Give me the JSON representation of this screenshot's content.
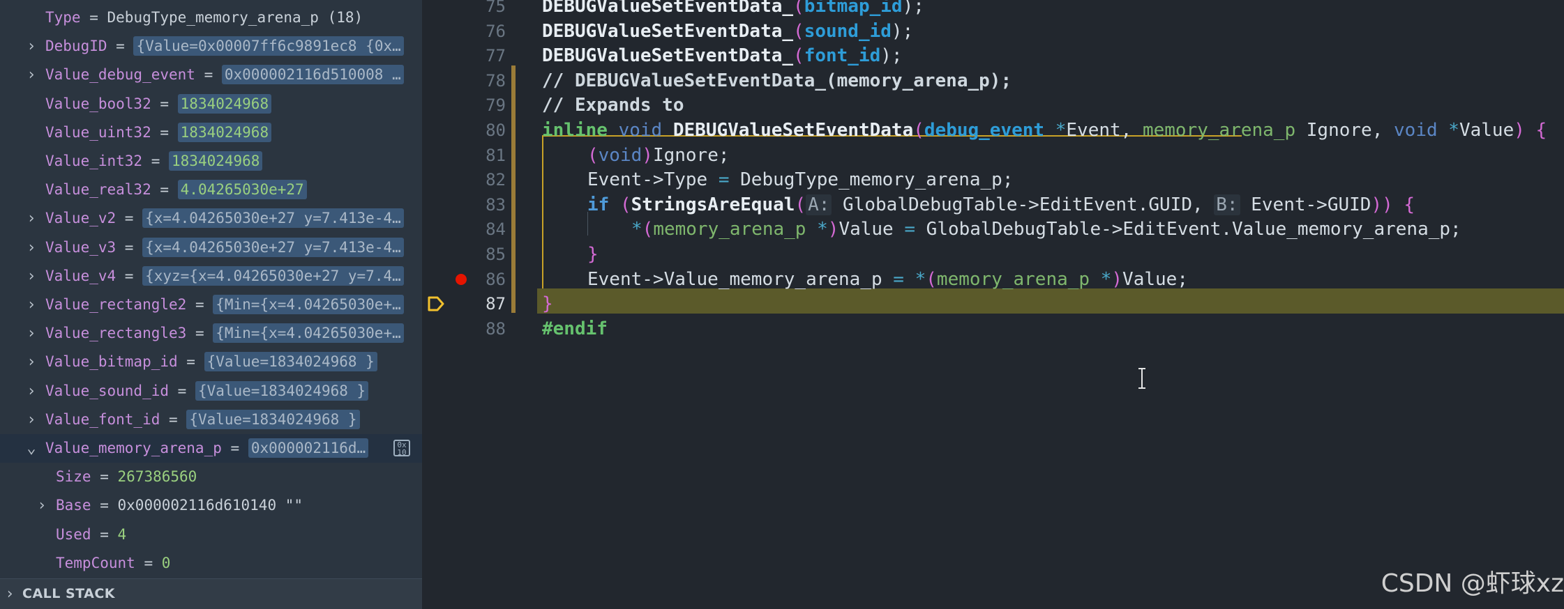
{
  "variables": [
    {
      "expand": "",
      "name": "Type",
      "eq": " = ",
      "value": "DebugType_memory_arena_p (18)",
      "style": "plain"
    },
    {
      "expand": "›",
      "name": "DebugID",
      "eq": " = ",
      "value": "{Value=0x00007ff6c9891ec8 {0x…",
      "style": "hl"
    },
    {
      "expand": "›",
      "name": "Value_debug_event",
      "eq": " = ",
      "value": "0x000002116d510008 …",
      "style": "hl"
    },
    {
      "expand": "",
      "name": "Value_bool32",
      "eq": " = ",
      "value": "1834024968",
      "style": "hl-green"
    },
    {
      "expand": "",
      "name": "Value_uint32",
      "eq": " = ",
      "value": "1834024968",
      "style": "hl-green"
    },
    {
      "expand": "",
      "name": "Value_int32",
      "eq": " = ",
      "value": "1834024968",
      "style": "hl-green"
    },
    {
      "expand": "",
      "name": "Value_real32",
      "eq": " = ",
      "value": "4.04265030e+27",
      "style": "hl-green"
    },
    {
      "expand": "›",
      "name": "Value_v2",
      "eq": " = ",
      "value": "{x=4.04265030e+27 y=7.413e-4…",
      "style": "hl"
    },
    {
      "expand": "›",
      "name": "Value_v3",
      "eq": " = ",
      "value": "{x=4.04265030e+27 y=7.413e-4…",
      "style": "hl"
    },
    {
      "expand": "›",
      "name": "Value_v4",
      "eq": " = ",
      "value": "{xyz={x=4.04265030e+27 y=7.4…",
      "style": "hl"
    },
    {
      "expand": "›",
      "name": "Value_rectangle2",
      "eq": " = ",
      "value": "{Min={x=4.04265030e+…",
      "style": "hl"
    },
    {
      "expand": "›",
      "name": "Value_rectangle3",
      "eq": " = ",
      "value": "{Min={x=4.04265030e+…",
      "style": "hl"
    },
    {
      "expand": "›",
      "name": "Value_bitmap_id",
      "eq": " = ",
      "value": "{Value=1834024968 }",
      "style": "hl"
    },
    {
      "expand": "›",
      "name": "Value_sound_id",
      "eq": " = ",
      "value": "{Value=1834024968 }",
      "style": "hl"
    },
    {
      "expand": "›",
      "name": "Value_font_id",
      "eq": " = ",
      "value": "{Value=1834024968 }",
      "style": "hl"
    },
    {
      "expand": "⌄",
      "name": "Value_memory_arena_p",
      "eq": " = ",
      "value": "0x000002116d…",
      "style": "hl",
      "selected": true
    },
    {
      "expand": "",
      "name": "Size",
      "eq": " = ",
      "value": "267386560",
      "style": "plain-green",
      "child": true
    },
    {
      "expand": "›",
      "name": "Base",
      "eq": " = ",
      "value": "0x000002116d610140 \"\"",
      "style": "plain",
      "child": true
    },
    {
      "expand": "",
      "name": "Used",
      "eq": " = ",
      "value": "4",
      "style": "plain-green",
      "child": true
    },
    {
      "expand": "",
      "name": "TempCount",
      "eq": " = ",
      "value": "0",
      "style": "plain-green",
      "child": true
    }
  ],
  "hex_icon_label": "0x\n10",
  "call_stack": {
    "chevron": "›",
    "label": "CALL STACK"
  },
  "editor": {
    "line_numbers": [
      "75",
      "76",
      "77",
      "78",
      "79",
      "80",
      "81",
      "82",
      "83",
      "84",
      "85",
      "86",
      "87",
      "88"
    ],
    "current_line": "87",
    "breakpoint_line": "86",
    "code": {
      "l75": {
        "fn": "DEBUGValueSetEventData_",
        "p1": "(",
        "arg": "bitmap_id",
        "p2": ");"
      },
      "l76": {
        "fn": "DEBUGValueSetEventData_",
        "p1": "(",
        "arg": "sound_id",
        "p2": ");"
      },
      "l77": {
        "fn": "DEBUGValueSetEventData_",
        "p1": "(",
        "arg": "font_id",
        "p2": ");"
      },
      "l78": "// DEBUGValueSetEventData_(memory_arena_p);",
      "l79": "// Expands to",
      "l80": {
        "inline": "inline",
        "void": "void",
        "fn": "DEBUGValueSetEventData",
        "po": "(",
        "t1": "debug_event",
        "star1": " *",
        "a1": "Event, ",
        "t2": "memory_arena_p",
        "a2": " Ignore, ",
        "t3": "void",
        "star3": " *",
        "a3": "Value",
        "pc": ")",
        "brace": " {"
      },
      "l81": {
        "po": "(",
        "void": "void",
        "pc": ")",
        "rest": "Ignore;"
      },
      "l82": {
        "a": "Event->Type ",
        "eq": "=",
        "b": " DebugType_memory_arena_p;"
      },
      "l83": {
        "kw": "if",
        "sp": " ",
        "po": "(",
        "fn": "StringsAreEqual",
        "p2": "(",
        "hA": "A:",
        "a": " GlobalDebugTable->EditEvent.GUID, ",
        "hB": "B:",
        "b": " Event->GUID",
        "pc": "))",
        "brace": " {"
      },
      "l84": {
        "star": "*",
        "po": "(",
        "ty": "memory_arena_p",
        "st": " *",
        "pc": ")",
        "a": "Value ",
        "eq": "=",
        "b": " GlobalDebugTable->EditEvent.Value_memory_arena_p;"
      },
      "l85": "}",
      "l86": {
        "a": "Event->Value_memory_arena_p ",
        "eq": "=",
        "sp": " ",
        "star": "*",
        "po": "(",
        "ty": "memory_arena_p",
        "st": " *",
        "pc": ")",
        "b": "Value;"
      },
      "l87": "}",
      "l88": "#endif"
    }
  },
  "watermark": "CSDN @虾球xz",
  "colors": {
    "breakpoint": "#e51400",
    "current_line": "#5b5a2a",
    "exec_arrow": "#f2c12e"
  }
}
